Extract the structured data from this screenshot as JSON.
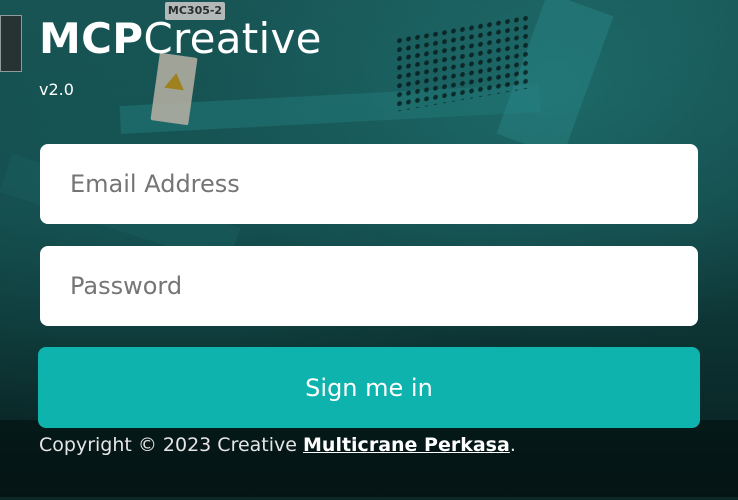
{
  "app": {
    "brand_bold": "MCP",
    "brand_light": "Creative",
    "version": "v2.0"
  },
  "background": {
    "machine_model": "MC305-2"
  },
  "form": {
    "email_placeholder": "Email Address",
    "email_value": "",
    "password_placeholder": "Password",
    "password_value": "",
    "submit_label": "Sign me in"
  },
  "footer": {
    "copyright_prefix": "Copyright © 2023 Creative ",
    "company_link": "Multicrane Perkasa",
    "suffix": "."
  },
  "colors": {
    "accent": "#0fb3ad",
    "field_background": "#ffffff",
    "text_light": "#ffffff"
  }
}
